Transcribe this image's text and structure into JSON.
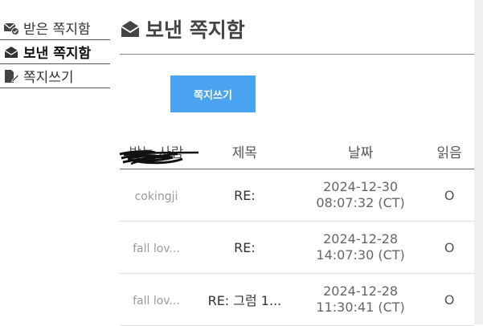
{
  "sidebar": {
    "items": [
      {
        "label": "받은 쪽지함",
        "icon": "envelope-check-icon",
        "active": false
      },
      {
        "label": "보낸 쪽지함",
        "icon": "open-envelope-icon",
        "active": true
      },
      {
        "label": "쪽지쓰기",
        "icon": "file-edit-icon",
        "active": false
      }
    ]
  },
  "main": {
    "title": "보낸 쪽지함",
    "title_icon": "open-envelope-icon",
    "write_button": "쪽지쓰기",
    "table": {
      "headers": [
        "받는 사람",
        "제목",
        "날짜",
        "읽음"
      ],
      "rows": [
        {
          "recipient": "cokingji",
          "subject": "RE:",
          "date_line1": "2024-12-30",
          "date_line2": "08:07:32 (CT)",
          "read": "O"
        },
        {
          "recipient": "fall lov...",
          "subject": "RE:",
          "date_line1": "2024-12-28",
          "date_line2": "14:07:30 (CT)",
          "read": "O"
        },
        {
          "recipient": "fall lov...",
          "subject": "RE: 그럼 1...",
          "date_line1": "2024-12-28",
          "date_line2": "11:30:41 (CT)",
          "read": "O"
        }
      ]
    }
  },
  "colors": {
    "accent": "#4aa3f0",
    "text": "#333333"
  }
}
